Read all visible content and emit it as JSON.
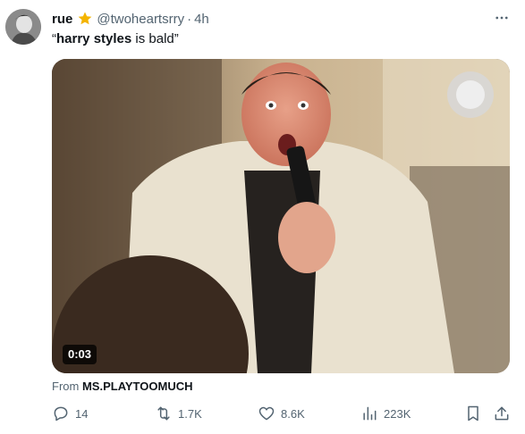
{
  "author": {
    "name": "rue",
    "handle": "@twoheartsrry",
    "separator": "·",
    "time": "4h"
  },
  "tweet": {
    "quote_open": "“",
    "bold_text": "harry styles",
    "rest_text": " is bald",
    "quote_close": "”"
  },
  "media": {
    "duration": "0:03",
    "from_label": "From",
    "from_account": "MS.PLAYTOOMUCH"
  },
  "actions": {
    "replies": "14",
    "reposts": "1.7K",
    "likes": "8.6K",
    "views": "223K"
  },
  "colors": {
    "secondary_text": "#536471",
    "primary_text": "#0f1419",
    "star": "#f4b400"
  },
  "icons": [
    "more-icon",
    "verified-star-icon",
    "reply-icon",
    "repost-icon",
    "like-icon",
    "views-icon",
    "bookmark-icon",
    "share-icon"
  ]
}
